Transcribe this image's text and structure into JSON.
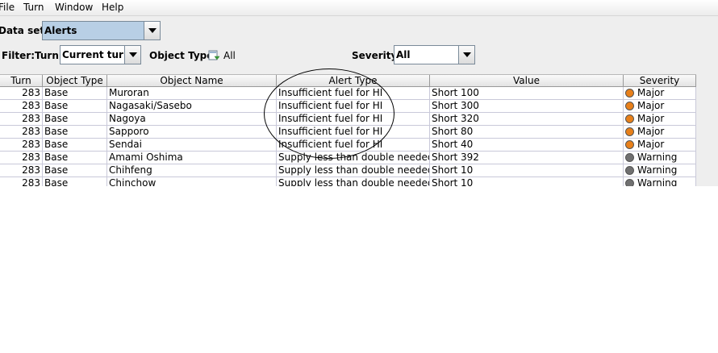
{
  "menu": {
    "items": [
      {
        "label": "File"
      },
      {
        "label": "Turn"
      },
      {
        "label": "Window"
      },
      {
        "label": "Help"
      }
    ]
  },
  "dataset": {
    "label": "Data set:",
    "value": "Alerts"
  },
  "filter": {
    "label": "Filter:",
    "turn_label": "Turn:",
    "turn_value": "Current turn",
    "objtype_label": "Object Type:",
    "objtype_value": "All",
    "severity_label": "Severity:",
    "severity_value": "All"
  },
  "table": {
    "headers": [
      "Turn",
      "Object Type",
      "Object Name",
      "Alert Type",
      "Value",
      "Severity"
    ],
    "rows": [
      {
        "turn": "283",
        "type": "Base",
        "name": "Muroran",
        "alert": "Insufficient fuel for HI",
        "value": "Short 100",
        "severity": "Major",
        "color": "#e8801a"
      },
      {
        "turn": "283",
        "type": "Base",
        "name": "Nagasaki/Sasebo",
        "alert": "Insufficient fuel for HI",
        "value": "Short 300",
        "severity": "Major",
        "color": "#e8801a"
      },
      {
        "turn": "283",
        "type": "Base",
        "name": "Nagoya",
        "alert": "Insufficient fuel for HI",
        "value": "Short 320",
        "severity": "Major",
        "color": "#e8801a"
      },
      {
        "turn": "283",
        "type": "Base",
        "name": "Sapporo",
        "alert": "Insufficient fuel for HI",
        "value": "Short 80",
        "severity": "Major",
        "color": "#e8801a"
      },
      {
        "turn": "283",
        "type": "Base",
        "name": "Sendai",
        "alert": "Insufficient fuel for HI",
        "value": "Short 40",
        "severity": "Major",
        "color": "#e8801a"
      },
      {
        "turn": "283",
        "type": "Base",
        "name": "Amami Oshima",
        "alert": "Supply less than double needed",
        "value": "Short 392",
        "severity": "Warning",
        "color": "#707070"
      },
      {
        "turn": "283",
        "type": "Base",
        "name": "Chihfeng",
        "alert": "Supply less than double needed",
        "value": "Short 10",
        "severity": "Warning",
        "color": "#707070"
      },
      {
        "turn": "283",
        "type": "Base",
        "name": "Chinchow",
        "alert": "Supply less than double needed",
        "value": "Short 10",
        "severity": "Warning",
        "color": "#707070"
      }
    ]
  }
}
